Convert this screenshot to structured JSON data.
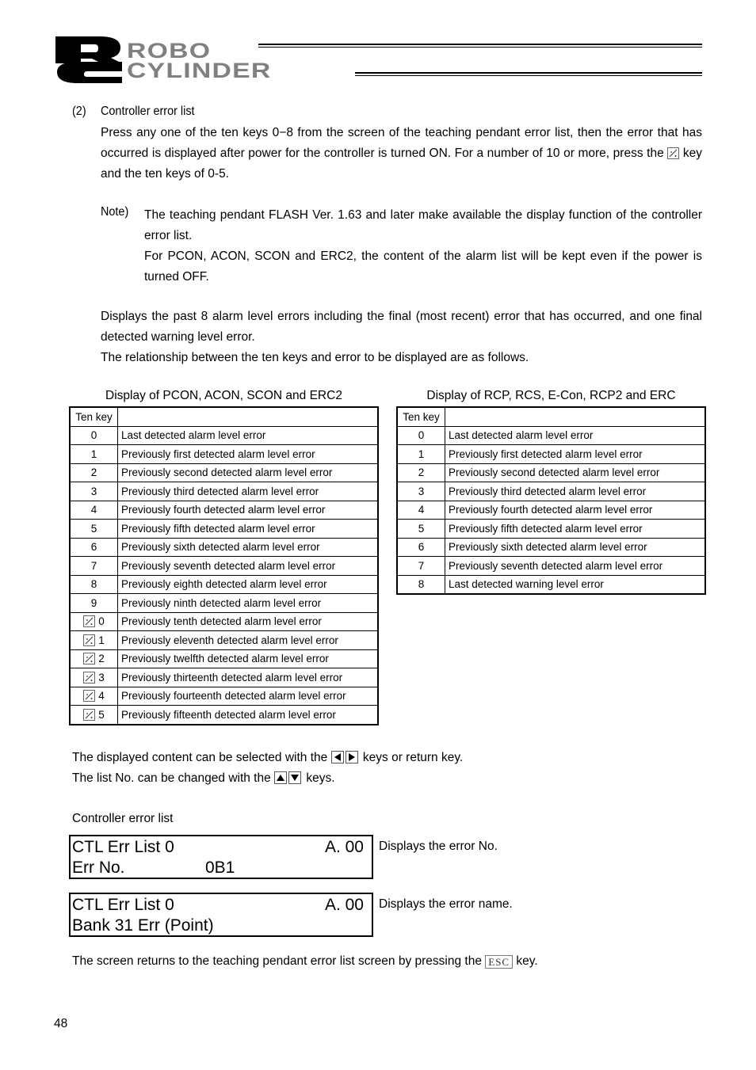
{
  "header": {
    "logo_letters": "RC",
    "logo_line1": "ROBO",
    "logo_line2": "CYLINDER"
  },
  "section": {
    "number": "(2)",
    "title": "Controller error list",
    "intro_part1": "Press any one of the ten keys 0−8 from the screen of the teaching pendant error list, then the error that has occurred is displayed after power for the controller is turned ON. For a number of 10 or more, press the",
    "intro_part2": "key and the ten keys of 0-5.",
    "note_label": "Note)",
    "note_line1": "The teaching pendant FLASH Ver. 1.63 and later make available the display function of the controller error list.",
    "note_line2": "For PCON, ACON, SCON and ERC2, the content of the alarm list will be kept even if the power is turned OFF.",
    "desc_line1": "Displays the past 8 alarm level errors including the final (most recent) error that has occurred, and one final detected warning level error.",
    "desc_line2": "The relationship between the ten keys and error to be displayed are as follows."
  },
  "icons": {
    "special_key": "slash-dot-key-icon",
    "left_key": "left-arrow-key-icon",
    "right_key": "right-arrow-key-icon",
    "up_key": "up-arrow-key-icon",
    "down_key": "down-arrow-key-icon",
    "esc_key_label": "ESC"
  },
  "table_left": {
    "caption": "Display of PCON, ACON, SCON and ERC2",
    "header": [
      "Ten key",
      ""
    ],
    "rows": [
      {
        "key": "0",
        "special": false,
        "desc": "Last detected alarm level error"
      },
      {
        "key": "1",
        "special": false,
        "desc": "Previously first detected alarm level error"
      },
      {
        "key": "2",
        "special": false,
        "desc": "Previously second detected alarm level error"
      },
      {
        "key": "3",
        "special": false,
        "desc": "Previously third detected alarm level error"
      },
      {
        "key": "4",
        "special": false,
        "desc": "Previously fourth detected alarm level error"
      },
      {
        "key": "5",
        "special": false,
        "desc": "Previously fifth detected alarm level error"
      },
      {
        "key": "6",
        "special": false,
        "desc": "Previously sixth detected alarm level error"
      },
      {
        "key": "7",
        "special": false,
        "desc": "Previously seventh detected alarm level error"
      },
      {
        "key": "8",
        "special": false,
        "desc": "Previously eighth detected alarm level error"
      },
      {
        "key": "9",
        "special": false,
        "desc": "Previously ninth detected alarm level error"
      },
      {
        "key": "0",
        "special": true,
        "desc": "Previously tenth detected alarm level error"
      },
      {
        "key": "1",
        "special": true,
        "desc": "Previously eleventh detected alarm level error"
      },
      {
        "key": "2",
        "special": true,
        "desc": "Previously twelfth detected alarm level error"
      },
      {
        "key": "3",
        "special": true,
        "desc": "Previously thirteenth detected alarm level error"
      },
      {
        "key": "4",
        "special": true,
        "desc": "Previously fourteenth detected alarm level error"
      },
      {
        "key": "5",
        "special": true,
        "desc": "Previously fifteenth detected alarm level error"
      }
    ]
  },
  "table_right": {
    "caption": "Display of RCP, RCS, E-Con, RCP2 and ERC",
    "header": [
      "Ten key",
      ""
    ],
    "rows": [
      {
        "key": "0",
        "special": false,
        "desc": "Last detected alarm level error"
      },
      {
        "key": "1",
        "special": false,
        "desc": "Previously first detected alarm level error"
      },
      {
        "key": "2",
        "special": false,
        "desc": "Previously second detected alarm level error"
      },
      {
        "key": "3",
        "special": false,
        "desc": "Previously third detected alarm level error"
      },
      {
        "key": "4",
        "special": false,
        "desc": "Previously fourth detected alarm level error"
      },
      {
        "key": "5",
        "special": false,
        "desc": "Previously fifth detected alarm level error"
      },
      {
        "key": "6",
        "special": false,
        "desc": "Previously sixth detected alarm level error"
      },
      {
        "key": "7",
        "special": false,
        "desc": "Previously seventh detected alarm level error"
      },
      {
        "key": "8",
        "special": false,
        "desc": "Last detected warning level error"
      }
    ]
  },
  "navigation": {
    "select_part1": "The displayed content can be selected with the",
    "select_part2": "keys or return key.",
    "list_part1": "The list No. can be changed with the",
    "list_part2": "keys."
  },
  "screens": {
    "label": "Controller error list",
    "screen1": {
      "line1_left": "CTL Err List 0",
      "line1_right": "A. 00",
      "line2_label": "Err No.",
      "line2_value": "0B1",
      "note": "Displays the error No."
    },
    "screen2": {
      "line1_left": "CTL Err List 0",
      "line1_right": "A. 00",
      "line2_label": "Bank 31 Err (Point)",
      "note": "Displays the error name."
    }
  },
  "footer": {
    "esc_part1": "The screen returns to the teaching pendant error list screen by pressing the",
    "esc_part2": "key.",
    "page_number": "48"
  }
}
